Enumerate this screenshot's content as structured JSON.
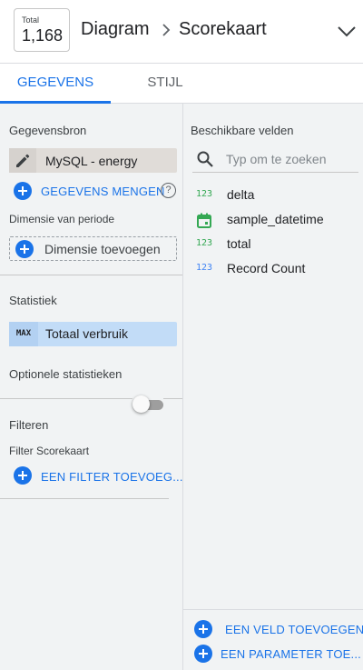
{
  "header": {
    "chart_label": "Total",
    "chart_value": "1,168",
    "breadcrumb_1": "Diagram",
    "breadcrumb_2": "Scorekaart"
  },
  "tabs": [
    {
      "label": "GEGEVENS",
      "active": true
    },
    {
      "label": "STIJL",
      "active": false
    }
  ],
  "left": {
    "data_source_title": "Gegevensbron",
    "data_source": "MySQL - energy",
    "blend_label": "GEGEVENS MENGEN",
    "period_dim_title": "Dimensie van periode",
    "add_dimension": "Dimensie toevoegen",
    "metric_title": "Statistiek",
    "metric": {
      "agg": "MAX",
      "label": "Totaal verbruik"
    },
    "optional_metrics_title": "Optionele statistieken",
    "optional_metrics_enabled": false,
    "filter_title": "Filteren",
    "filter_sub": "Filter Scorekaart",
    "add_filter": "EEN FILTER TOEVOEG..."
  },
  "right": {
    "title": "Beschikbare velden",
    "search_placeholder": "Typ om te zoeken",
    "fields": [
      {
        "name": "delta",
        "type": "number-dimension",
        "icon_text": "123",
        "color": "#34a853"
      },
      {
        "name": "sample_datetime",
        "type": "date",
        "icon_text": "",
        "color": "#34a853"
      },
      {
        "name": "total",
        "type": "number-dimension",
        "icon_text": "123",
        "color": "#34a853"
      },
      {
        "name": "Record Count",
        "type": "number-metric",
        "icon_text": "123",
        "color": "#4285f4"
      }
    ],
    "add_field": "EEN VELD TOEVOEGEN",
    "add_parameter": "EEN PARAMETER TOE..."
  },
  "colors": {
    "accent": "#1a73e8",
    "panel_bg": "#f1f3f4",
    "metric_chip": "#c2dcf7",
    "dimension_icon": "#34a853",
    "metric_icon": "#4285f4"
  }
}
